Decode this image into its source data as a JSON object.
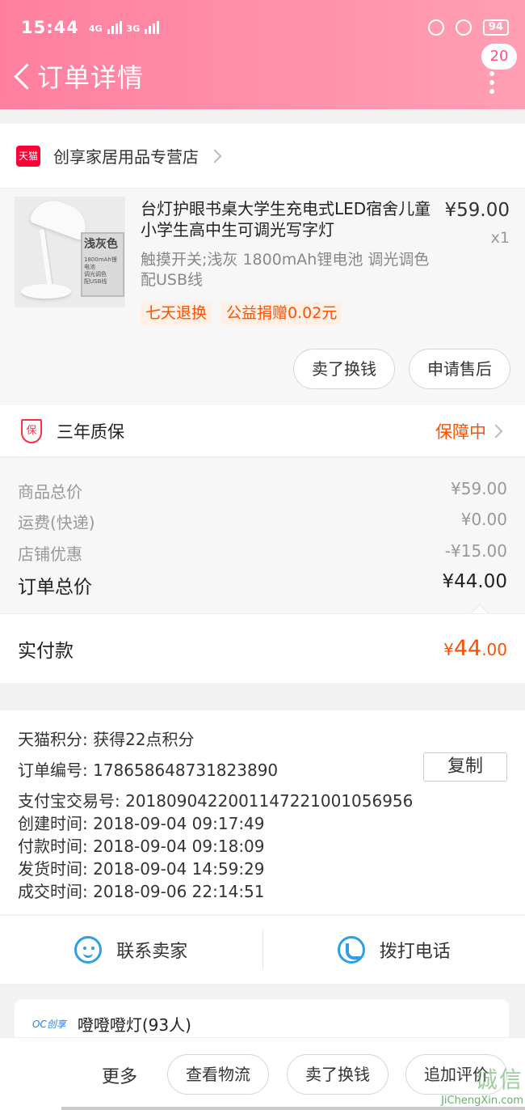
{
  "status_bar": {
    "time": "15:44",
    "net1": "4G",
    "net2": "3G",
    "battery": "94"
  },
  "nav": {
    "title": "订单详情",
    "badge": "20"
  },
  "shop": {
    "icon_text": "天猫",
    "name": "创享家居用品专营店"
  },
  "product": {
    "image_box_title": "浅灰色",
    "image_box_sub": "1800mAh锂电池\n调光调色\n配USB线",
    "title": "台灯护眼书桌大学生充电式LED宿舍儿童小学生高中生可调光写字灯",
    "sku": "触摸开关;浅灰 1800mAh锂电池 调光调色 配USB线",
    "price": "¥59.00",
    "qty": "x1",
    "tags": [
      "七天退换",
      "公益捐赠0.02元"
    ],
    "buttons": [
      "卖了换钱",
      "申请售后"
    ]
  },
  "warranty": {
    "icon_text": "保",
    "name": "三年质保",
    "status": "保障中"
  },
  "totals": {
    "goods_label": "商品总价",
    "goods_value": "¥59.00",
    "shipping_label": "运费(快递)",
    "shipping_value": "¥0.00",
    "discount_label": "店铺优惠",
    "discount_value": "-¥15.00",
    "order_total_label": "订单总价",
    "order_total_value": "¥44.00"
  },
  "paid": {
    "label": "实付款",
    "currency": "¥",
    "integer": "44",
    "decimal": ".00"
  },
  "info": {
    "points": "天猫积分:  获得22点积分",
    "order_no": "订单编号:  178658648731823890",
    "alipay_no": "支付宝交易号:  2018090422001147221001056956",
    "created": "创建时间:  2018-09-04 09:17:49",
    "paid_time": "付款时间:  2018-09-04 09:18:09",
    "shipped": "发货时间:  2018-09-04 14:59:29",
    "completed": "成交时间:  2018-09-06 22:14:51",
    "copy_label": "复制"
  },
  "contact": {
    "seller": "联系卖家",
    "phone": "拨打电话"
  },
  "reco": {
    "logo": "OC创享",
    "name": "噔噔噔灯(93人)"
  },
  "bottom": {
    "more": "更多",
    "buttons": [
      "查看物流",
      "卖了换钱",
      "追加评价"
    ]
  },
  "watermark": {
    "big": "诚信",
    "url": "JiChengXin.com"
  }
}
